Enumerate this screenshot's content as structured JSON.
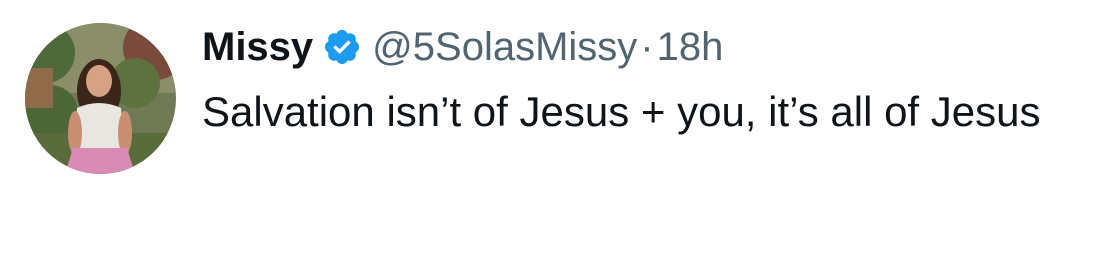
{
  "author": {
    "name": "Missy",
    "handle": "@5SolasMissy",
    "verified": true
  },
  "meta": {
    "separator": "·",
    "time": "18h"
  },
  "tweet": {
    "text": "Salvation isn’t of Jesus + you, it’s all of Jesus"
  },
  "colors": {
    "verified_badge": "#1d9bf0",
    "secondary_text": "#536471",
    "primary_text": "#0f1419"
  },
  "icons": {
    "verified": "verified-badge-icon",
    "avatar": "profile-photo"
  }
}
